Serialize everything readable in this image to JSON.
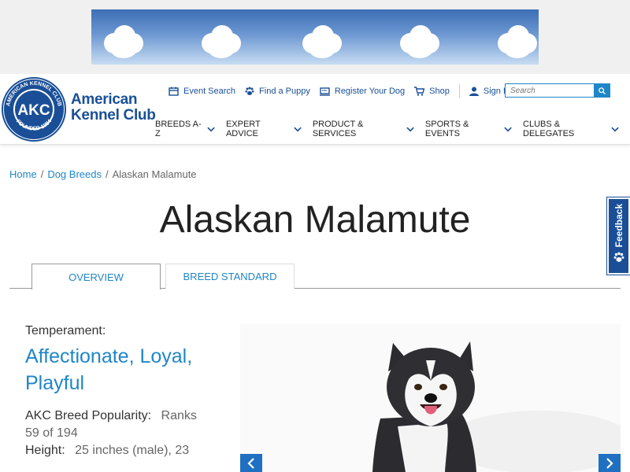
{
  "header": {
    "logo": {
      "line1": "American",
      "line2": "Kennel Club",
      "seal_text": "AKC"
    },
    "utility_nav": [
      {
        "label": "Event Search",
        "icon": "calendar-icon"
      },
      {
        "label": "Find a Puppy",
        "icon": "paw-icon"
      },
      {
        "label": "Register Your Dog",
        "icon": "register-icon"
      },
      {
        "label": "Shop",
        "icon": "cart-icon"
      },
      {
        "label": "Sign In",
        "icon": "user-icon"
      }
    ],
    "search_placeholder": "Search",
    "main_nav": [
      {
        "label": "BREEDS A-Z"
      },
      {
        "label": "EXPERT ADVICE"
      },
      {
        "label": "PRODUCT & SERVICES"
      },
      {
        "label": "SPORTS & EVENTS"
      },
      {
        "label": "CLUBS & DELEGATES"
      }
    ]
  },
  "breadcrumb": {
    "home": "Home",
    "breeds": "Dog Breeds",
    "current": "Alaskan Malamute"
  },
  "page": {
    "title": "Alaskan Malamute"
  },
  "tabs": {
    "overview": "OVERVIEW",
    "standard": "BREED STANDARD"
  },
  "info": {
    "temperament_label": "Temperament:",
    "temperament_value": "Affectionate, Loyal, Playful",
    "popularity_label": "AKC Breed Popularity:",
    "popularity_value": "Ranks 59 of 194",
    "height_label": "Height:",
    "height_value": "25 inches (male), 23"
  },
  "feedback": {
    "label": "Feedback"
  },
  "colors": {
    "brand_navy": "#1a4f97",
    "link_blue": "#1f86c8",
    "arrow_blue": "#1f6fc2"
  }
}
